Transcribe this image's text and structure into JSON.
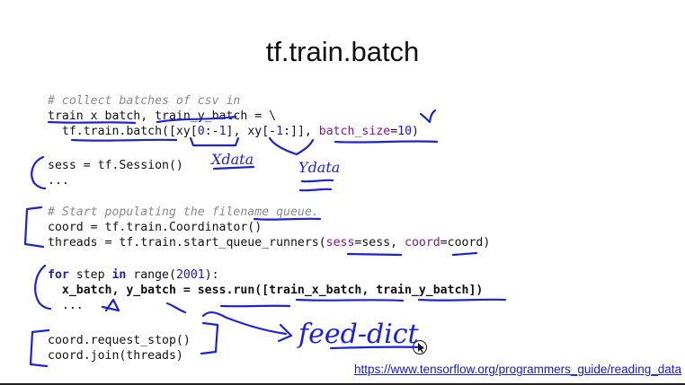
{
  "slide": {
    "title": "tf.train.batch",
    "link": "https://www.tensorflow.org/programmers_guide/reading_data"
  },
  "code": {
    "b1": {
      "comment": "# collect batches of csv in",
      "l2": "train_x_batch, train_y_batch = \\",
      "l3_indent": "  ",
      "l3_fn": "tf.train.batch([xy[",
      "l3_n1": "0",
      "l3_s1": ":-",
      "l3_n2": "1",
      "l3_s2": "], xy[-",
      "l3_n3": "1",
      "l3_s3": ":]], ",
      "l3_kw": "batch_size",
      "l3_eq": "=",
      "l3_n4": "10",
      "l3_end": ")"
    },
    "b2": {
      "l1": "sess = tf.Session()",
      "l2": "..."
    },
    "b3": {
      "comment": "# Start populating the filename queue.",
      "l2": "coord = tf.train.Coordinator()",
      "l3_a": "threads = tf.train.start_queue_runners(",
      "l3_k1": "sess",
      "l3_b": "=sess, ",
      "l3_k2": "coord",
      "l3_c": "=coord)"
    },
    "b4": {
      "kw_for": "for",
      "l1_a": " step ",
      "kw_in": "in",
      "l1_b": " range(",
      "l1_num": "2001",
      "l1_c": "):",
      "l2_indent": "  ",
      "l2": "x_batch, y_batch = sess.run([train_x_batch, train_y_batch])",
      "l3_indent": "  ",
      "l3": "..."
    },
    "b5": {
      "l1": "coord.request_stop()",
      "l2": "coord.join(threads)"
    }
  },
  "annotations": {
    "xdata": "Xdata",
    "ydata": "Ydata",
    "feed_dict": "feed-dict"
  },
  "colors": {
    "ink": "#1e22d6",
    "number": "#1a1ac8",
    "keyword_arg": "#7a1a8a",
    "comment": "#8a8a8a"
  }
}
